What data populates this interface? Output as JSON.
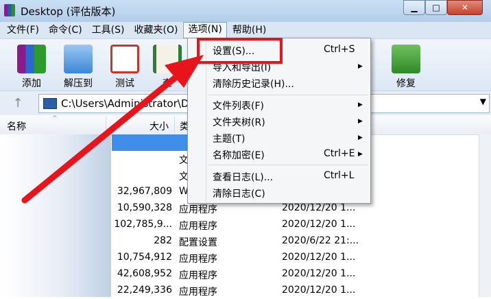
{
  "window": {
    "title": "Desktop (评估版本)"
  },
  "menubar": [
    "文件(F)",
    "命令(C)",
    "工具(S)",
    "收藏夹(O)",
    "选项(N)",
    "帮助(H)"
  ],
  "toolbar": [
    {
      "label": "添加",
      "icon": "books-add-icon"
    },
    {
      "label": "解压到",
      "icon": "folder-extract-icon"
    },
    {
      "label": "测试",
      "icon": "clipboard-check-icon"
    },
    {
      "label": "查",
      "icon": "book-view-icon"
    },
    {
      "label": "修复",
      "icon": "repair-kit-icon"
    }
  ],
  "path": {
    "value": "C:\\Users\\Administrator\\De"
  },
  "columns": {
    "name": "名称",
    "size": "大小",
    "type": "类"
  },
  "rows": [
    {
      "size": "",
      "type": "文",
      "date": ""
    },
    {
      "size": "",
      "type": "文",
      "date": ""
    },
    {
      "size": "32,967,809",
      "type": "W",
      "date": ""
    },
    {
      "size": "10,590,328",
      "type": "应用程序",
      "date": "2020/12/20 1..."
    },
    {
      "size": "102,785,9...",
      "type": "应用程序",
      "date": "2020/12/20 1..."
    },
    {
      "size": "282",
      "type": "配置设置",
      "date": "2020/6/22 21:..."
    },
    {
      "size": "10,754,912",
      "type": "应用程序",
      "date": "2020/12/20 1..."
    },
    {
      "size": "42,608,952",
      "type": "应用程序",
      "date": "2020/12/20 1..."
    },
    {
      "size": "22,249,336",
      "type": "应用程序",
      "date": "2020/12/20 1..."
    }
  ],
  "options_menu": [
    {
      "label": "设置(S)...",
      "shortcut": "Ctrl+S",
      "submenu": false
    },
    {
      "label": "导入和导出(I)",
      "shortcut": "",
      "submenu": true
    },
    {
      "label": "清除历史记录(H)...",
      "shortcut": "",
      "submenu": false
    },
    {
      "label": "文件列表(F)",
      "shortcut": "",
      "submenu": true
    },
    {
      "label": "文件夹树(R)",
      "shortcut": "",
      "submenu": true
    },
    {
      "label": "主题(T)",
      "shortcut": "",
      "submenu": true
    },
    {
      "label": "名称加密(E)",
      "shortcut": "Ctrl+E",
      "submenu": true
    },
    {
      "label": "查看日志(L)...",
      "shortcut": "Ctrl+L",
      "submenu": false
    },
    {
      "label": "清除日志(C)",
      "shortcut": "",
      "submenu": false
    }
  ],
  "colors": {
    "highlight": "#e8141b",
    "selection": "#3f8ee8"
  }
}
